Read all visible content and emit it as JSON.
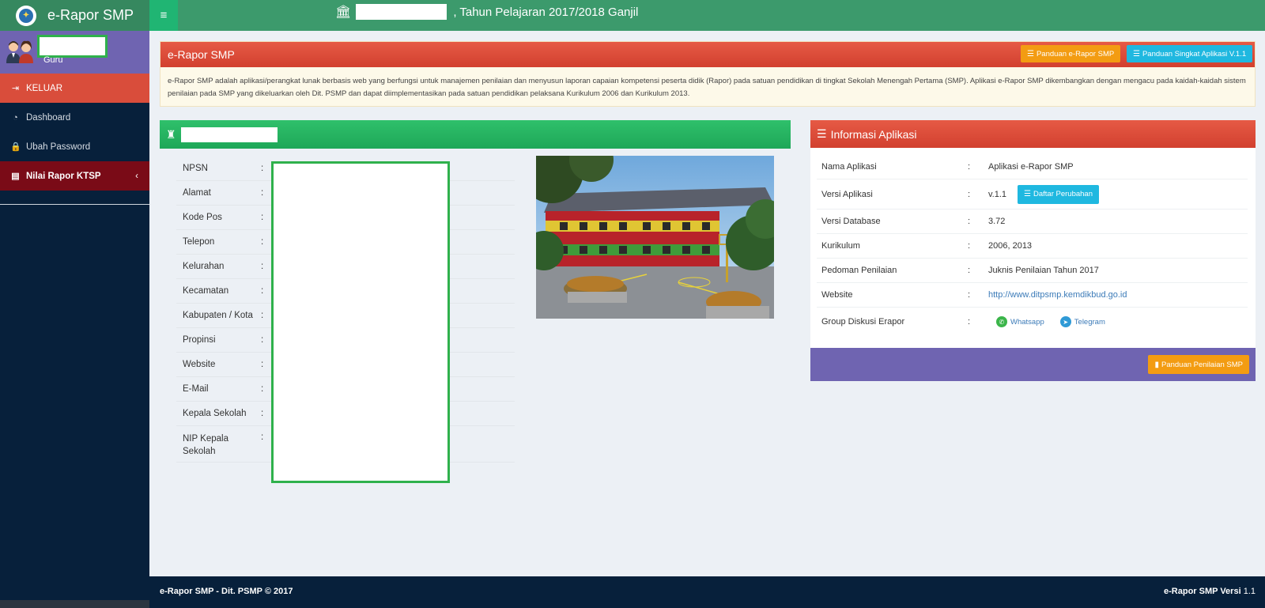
{
  "brand": {
    "title": "e-Rapor SMP"
  },
  "header": {
    "title_suffix": ", Tahun Pelajaran 2017/2018 Ganjil"
  },
  "user": {
    "role": "Guru"
  },
  "sidebar": {
    "items": [
      {
        "label": "KELUAR"
      },
      {
        "label": "Dashboard"
      },
      {
        "label": "Ubah Password"
      },
      {
        "label": "Nilai Rapor KTSP"
      }
    ]
  },
  "intro": {
    "title": "e-Rapor SMP",
    "btn_panduan": "Panduan e-Rapor SMP",
    "btn_singkat": "Panduan Singkat Aplikasi V.1.1",
    "description": "e-Rapor SMP adalah aplikasi/perangkat lunak berbasis web yang berfungsi untuk manajemen penilaian dan menyusun laporan capaian kompetensi peserta didik (Rapor) pada satuan pendidikan di tingkat Sekolah Menengah Pertama (SMP). Aplikasi e-Rapor SMP dikembangkan dengan mengacu pada kaidah-kaidah sistem penilaian pada SMP yang dikeluarkan oleh Dit. PSMP dan dapat diimplementasikan pada satuan pendidikan pelaksana Kurikulum 2006 dan Kurikulum 2013."
  },
  "school": {
    "fields": [
      {
        "label": "NPSN"
      },
      {
        "label": "Alamat"
      },
      {
        "label": "Kode Pos"
      },
      {
        "label": "Telepon"
      },
      {
        "label": "Kelurahan"
      },
      {
        "label": "Kecamatan"
      },
      {
        "label": "Kabupaten / Kota"
      },
      {
        "label": "Propinsi"
      },
      {
        "label": "Website"
      },
      {
        "label": "E-Mail"
      },
      {
        "label": "Kepala Sekolah"
      },
      {
        "label": "NIP Kepala Sekolah"
      }
    ]
  },
  "app_info": {
    "title": "Informasi Aplikasi",
    "rows": [
      {
        "label": "Nama Aplikasi",
        "value": "Aplikasi e-Rapor SMP"
      },
      {
        "label": "Versi Aplikasi",
        "value": "v.1.1"
      },
      {
        "label": "Versi Database",
        "value": "3.72"
      },
      {
        "label": "Kurikulum",
        "value": "2006, 2013"
      },
      {
        "label": "Pedoman Penilaian",
        "value": "Juknis Penilaian Tahun 2017"
      },
      {
        "label": "Website",
        "value": "http://www.ditpsmp.kemdikbud.go.id"
      },
      {
        "label": "Group Diskusi Erapor",
        "value": ""
      }
    ],
    "btn_daftar": "Daftar Perubahan",
    "whatsapp": "Whatsapp",
    "telegram": "Telegram",
    "btn_panduan_penilaian": "Panduan Penilaian SMP"
  },
  "footer": {
    "left": "e-Rapor SMP - Dit. PSMP © 2017",
    "right_label": "e-Rapor SMP Versi",
    "right_version": "1.1"
  },
  "colors": {
    "header_green": "#3c9a6c",
    "sidebar_navy": "#07203b",
    "danger_red": "#d94d3b",
    "success_green": "#1ea758",
    "purple": "#6f64b1",
    "orange": "#f39c12",
    "cyan": "#1fb8e0"
  }
}
